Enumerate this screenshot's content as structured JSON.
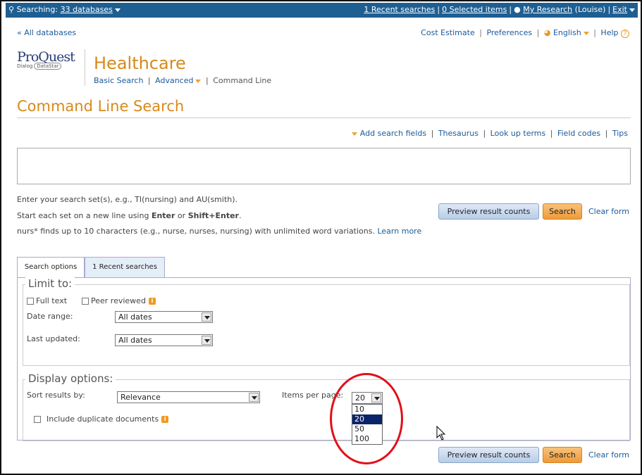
{
  "topbar": {
    "searching_prefix": "Searching:",
    "databases_link": "33 databases",
    "recent_searches": "1 Recent searches",
    "selected_items": "0 Selected items",
    "my_research": "My Research",
    "user": "(Louise)",
    "exit": "Exit"
  },
  "nav": {
    "back_link": "« All databases",
    "cost_estimate": "Cost Estimate",
    "preferences": "Preferences",
    "language": "English",
    "help": "Help"
  },
  "logo": {
    "name": "ProQuest",
    "sub1": "Dialog",
    "sub2": "DataStar"
  },
  "brand": "Healthcare",
  "subnav": {
    "basic": "Basic Search",
    "advanced": "Advanced",
    "command": "Command Line"
  },
  "page_title": "Command Line Search",
  "field_links": [
    "Add search fields",
    "Thesaurus",
    "Look up terms",
    "Field codes",
    "Tips"
  ],
  "command_input": {
    "value": ""
  },
  "hints": {
    "line1": "Enter your search set(s), e.g., TI(nursing) and AU(smith).",
    "line2_a": "Start each set on a new line using ",
    "line2_b": "Enter",
    "line2_c": " or ",
    "line2_d": "Shift+Enter",
    "line2_e": ".",
    "line3": "nurs* finds up to 10 characters (e.g., nurse, nurses, nursing) with unlimited word variations.",
    "learn_more": "Learn more"
  },
  "buttons": {
    "preview": "Preview result counts",
    "search": "Search",
    "clear": "Clear form"
  },
  "tabs": [
    {
      "label": "Search options",
      "active": true
    },
    {
      "label": "1 Recent searches",
      "active": false
    }
  ],
  "limit": {
    "legend": "Limit to:",
    "full_text": "Full text",
    "peer_reviewed": "Peer reviewed",
    "date_range_label": "Date range:",
    "date_range_value": "All dates",
    "last_updated_label": "Last updated:",
    "last_updated_value": "All dates"
  },
  "display": {
    "legend": "Display options:",
    "sort_label": "Sort results by:",
    "sort_value": "Relevance",
    "items_label": "Items per page:",
    "items_value": "20",
    "items_options": [
      "10",
      "20",
      "50",
      "100"
    ],
    "items_selected": "20",
    "duplicates": "Include duplicate documents"
  },
  "colors": {
    "topbar": "#1e5f92",
    "accent_orange": "#d68a1a",
    "annotation_red": "#e0101a",
    "selected_option": "#0a246a"
  }
}
